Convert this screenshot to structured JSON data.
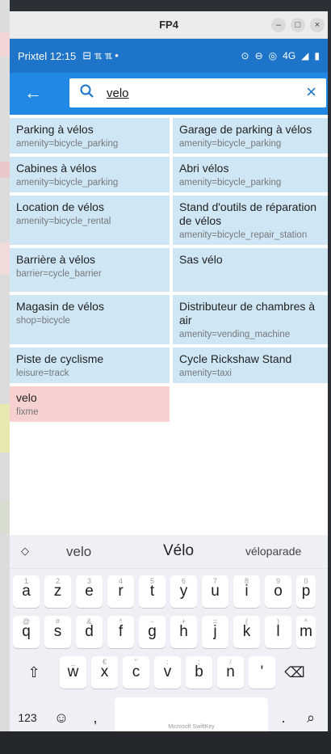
{
  "window": {
    "title": "FP4"
  },
  "status_bar": {
    "carrier_time": "Prixtel 12:15",
    "network": "4G"
  },
  "search": {
    "value": "velo"
  },
  "results": [
    [
      {
        "name": "Parking à vélos",
        "tag": "amenity=bicycle_parking"
      },
      {
        "name": "Garage de parking à vélos",
        "tag": "amenity=bicycle_parking"
      }
    ],
    [
      {
        "name": "Cabines à vélos",
        "tag": "amenity=bicycle_parking"
      },
      {
        "name": "Abri vélos",
        "tag": "amenity=bicycle_parking"
      }
    ],
    [
      {
        "name": "Location de vélos",
        "tag": "amenity=bicycle_rental"
      },
      {
        "name": "Stand d'outils de réparation de vélos",
        "tag": "amenity=bicycle_repair_station"
      }
    ],
    [
      {
        "name": "Barrière à vélos",
        "tag": "barrier=cycle_barrier"
      },
      {
        "name": "Sas vélo",
        "tag": ""
      }
    ],
    [
      {
        "name": "Magasin de vélos",
        "tag": "shop=bicycle"
      },
      {
        "name": "Distributeur de chambres à air",
        "tag": "amenity=vending_machine"
      }
    ],
    [
      {
        "name": "Piste de cyclisme",
        "tag": "leisure=track"
      },
      {
        "name": "Cycle Rickshaw Stand",
        "tag": "amenity=taxi"
      }
    ],
    [
      {
        "name": "velo",
        "tag": "fixme"
      }
    ]
  ],
  "keyboard": {
    "suggestions": [
      "velo",
      "Vélo",
      "véloparade"
    ],
    "row1": [
      {
        "k": "a",
        "h": "1"
      },
      {
        "k": "z",
        "h": "2"
      },
      {
        "k": "e",
        "h": "3"
      },
      {
        "k": "r",
        "h": "4"
      },
      {
        "k": "t",
        "h": "5"
      },
      {
        "k": "y",
        "h": "6"
      },
      {
        "k": "u",
        "h": "7"
      },
      {
        "k": "i",
        "h": "8"
      },
      {
        "k": "o",
        "h": "9"
      },
      {
        "k": "p",
        "h": "0"
      }
    ],
    "row2": [
      {
        "k": "q",
        "h": "@"
      },
      {
        "k": "s",
        "h": "#"
      },
      {
        "k": "d",
        "h": "&"
      },
      {
        "k": "f",
        "h": "*"
      },
      {
        "k": "g",
        "h": "-"
      },
      {
        "k": "h",
        "h": "+"
      },
      {
        "k": "j",
        "h": "="
      },
      {
        "k": "k",
        "h": "("
      },
      {
        "k": "l",
        "h": ")"
      },
      {
        "k": "m",
        "h": "^"
      }
    ],
    "row3": [
      {
        "k": "w",
        "h": "_"
      },
      {
        "k": "x",
        "h": "€"
      },
      {
        "k": "c",
        "h": "\""
      },
      {
        "k": "v",
        "h": ":"
      },
      {
        "k": "b",
        "h": ";"
      },
      {
        "k": "n",
        "h": "/"
      },
      {
        "k": "'",
        "h": ""
      }
    ],
    "num_key": "123",
    "space_brand": "Microsoft SwiftKey",
    "comma": ",",
    "period": "."
  },
  "colors": {
    "status_bar": "#1e74c8",
    "app_bar": "#2188e6",
    "card": "#cfe6f4",
    "card_warn": "#f7d0d0"
  }
}
